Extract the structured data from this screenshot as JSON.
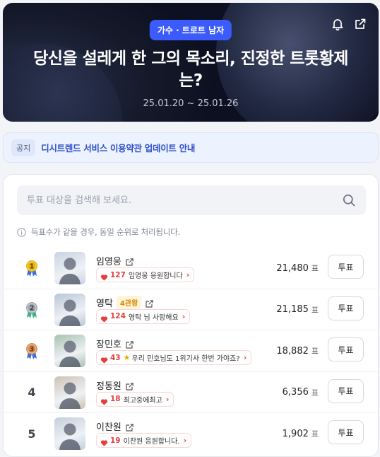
{
  "hero": {
    "category_tag": "가수 · 트로트 남자",
    "title": "당신을 설레게 한 그의 목소리, 진정한 트롯황제는?",
    "date_range": "25.01.20 ~ 25.01.26"
  },
  "notice": {
    "badge": "공지",
    "text": "디시트렌드 서비스 이용약관 업데이트 안내"
  },
  "search": {
    "placeholder": "투표 대상을 검색해 보세요."
  },
  "info_text": "득표수가 같을 경우, 동일 순위로 처리됩니다.",
  "colors": {
    "accent": "#3b5bfd",
    "gold": "#e8b300",
    "silver": "#9aa6bd",
    "bronze": "#d98956",
    "cheer_red": "#e53e3e"
  },
  "vote_label": "투표",
  "vote_unit": "표",
  "candidates": [
    {
      "rank": "1",
      "medal": "gold",
      "name": "임영웅",
      "badge": "",
      "cheer_count": "127",
      "cheer_msg": "임영웅 응원합니다",
      "cheer_star": false,
      "votes": "21,480"
    },
    {
      "rank": "2",
      "medal": "silver",
      "name": "영탁",
      "badge": "4관왕",
      "cheer_count": "124",
      "cheer_msg": "영탁 님 사랑해요",
      "cheer_star": false,
      "votes": "21,185"
    },
    {
      "rank": "3",
      "medal": "bronze",
      "name": "장민호",
      "badge": "",
      "cheer_count": "43",
      "cheer_msg": "우리 민호님도 1위기사 한번 가야죠?",
      "cheer_star": true,
      "votes": "18,882"
    },
    {
      "rank": "4",
      "medal": "",
      "name": "정동원",
      "badge": "",
      "cheer_count": "18",
      "cheer_msg": "최고중에최고",
      "cheer_star": false,
      "votes": "6,356"
    },
    {
      "rank": "5",
      "medal": "",
      "name": "이찬원",
      "badge": "",
      "cheer_count": "19",
      "cheer_msg": "이찬원 응원합니다.",
      "cheer_star": false,
      "votes": "1,902"
    }
  ]
}
